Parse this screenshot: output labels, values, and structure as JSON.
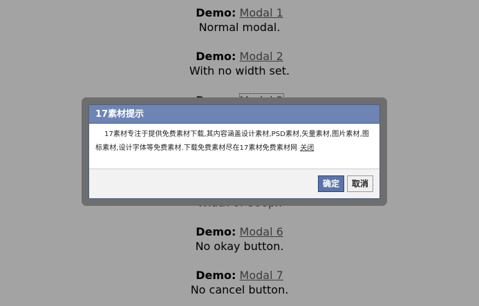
{
  "demos": [
    {
      "label": "Demo:",
      "link": "Modal 1",
      "desc": "Normal modal."
    },
    {
      "label": "Demo:",
      "link": "Modal 2",
      "desc": "With no width set."
    },
    {
      "label": "Demo:",
      "link": "Modal 3",
      "desc": ""
    },
    {
      "label": "",
      "link": "",
      "desc": "Width of 800px"
    },
    {
      "label": "Demo:",
      "link": "Modal 6",
      "desc": "No okay button."
    },
    {
      "label": "Demo:",
      "link": "Modal 7",
      "desc": "No cancel button."
    }
  ],
  "modal": {
    "title": "17素材提示",
    "body": "17素材专注于提供免费素材下载,其内容涵盖设计素材,PSD素材,矢量素材,图片素材,图标素材,设计字体等免费素材.下载免费素材尽在17素材免费素材网",
    "close_link": "关闭",
    "ok_label": "确定",
    "cancel_label": "取消"
  },
  "colors": {
    "overlay": "#a3a3a3",
    "modal_header": "#6d84b4",
    "ok_button": "#5b74a8"
  }
}
